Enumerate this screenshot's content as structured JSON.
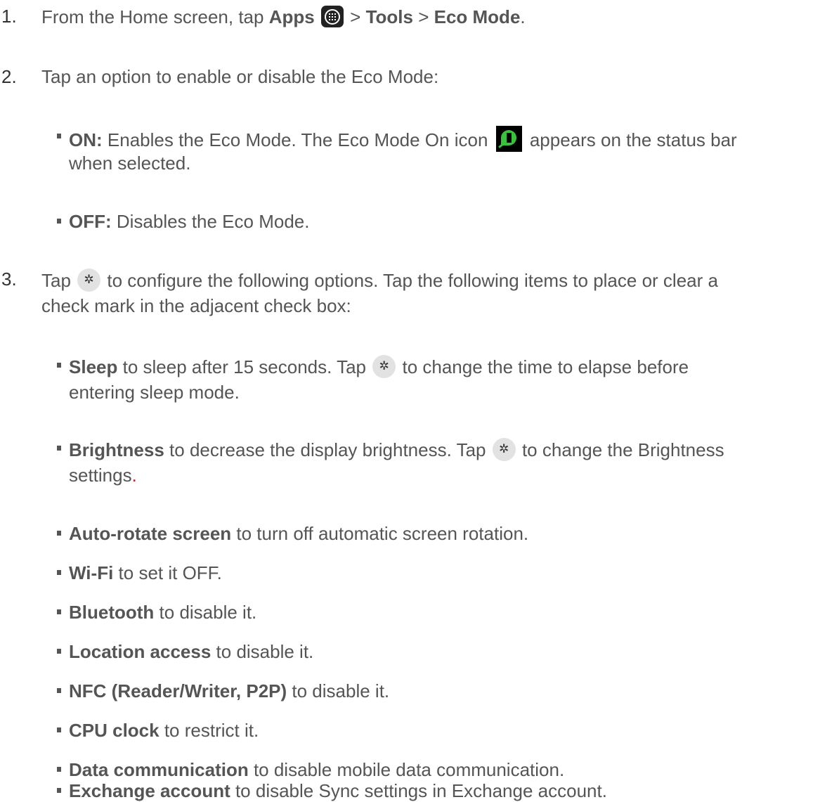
{
  "steps": [
    {
      "number": "1.",
      "text_a": "From the Home screen, tap ",
      "apps": "Apps",
      "text_b": " > ",
      "tools": "Tools",
      "text_c": " > ",
      "eco": "Eco Mode",
      "text_d": "."
    },
    {
      "number": "2.",
      "text": "Tap an option to enable or disable the Eco Mode:",
      "bullets": [
        {
          "label": "ON:",
          "text_a": " Enables the Eco Mode. The Eco Mode On icon ",
          "text_b": " appears on the status bar",
          "text_c": "when selected."
        },
        {
          "label": "OFF:",
          "text": " Disables the Eco Mode."
        }
      ]
    },
    {
      "number": "3.",
      "text_a": "Tap ",
      "text_b": " to configure the following options. Tap the following items to place or clear a",
      "text_c": "check mark in the adjacent check box:",
      "bullets": [
        {
          "label": "Sleep",
          "text_a": " to sleep after 15 seconds. Tap ",
          "text_b": " to change the time to elapse before",
          "text_c": "entering sleep mode."
        },
        {
          "label": "Brightness",
          "text_a": " to decrease the display brightness. Tap ",
          "text_b": " to change the Brightness",
          "text_c": "settings",
          "text_d": "."
        },
        {
          "label": "Auto-rotate screen",
          "text": " to turn off automatic screen rotation."
        },
        {
          "label": "Wi-Fi",
          "text": " to set it OFF."
        },
        {
          "label": "Bluetooth",
          "text": " to disable it."
        },
        {
          "label": "Location access",
          "text": " to disable it."
        },
        {
          "label": "NFC (Reader/Writer, P2P)",
          "text": " to disable it."
        },
        {
          "label": "CPU clock",
          "text": " to restrict it."
        },
        {
          "label": "Data communication",
          "text": " to disable mobile data communication."
        },
        {
          "label": "Exchange account",
          "text": " to disable Sync settings in Exchange account."
        }
      ]
    }
  ],
  "icons": {
    "apps": "apps-grid-icon",
    "eco_mode_on": "eco-mode-on-icon",
    "settings": "gear-icon"
  },
  "colors": {
    "text": "#555555",
    "number": "#333333",
    "eco_leaf": "#39c23b",
    "period_accent": "#d02020"
  }
}
